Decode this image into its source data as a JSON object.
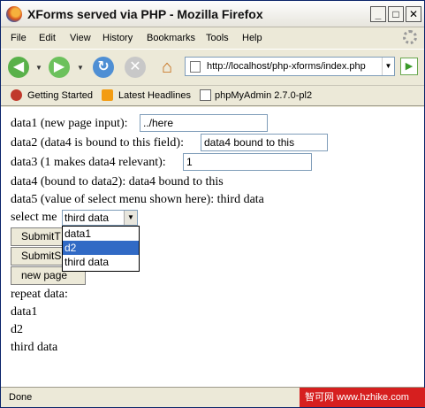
{
  "window": {
    "title": "XForms served via PHP - Mozilla Firefox"
  },
  "menu": [
    "File",
    "Edit",
    "View",
    "History",
    "Bookmarks",
    "Tools",
    "Help"
  ],
  "address": {
    "url": "http://localhost/php-xforms/index.php"
  },
  "bookmarks": [
    "Getting Started",
    "Latest Headlines",
    "phpMyAdmin 2.7.0-pl2"
  ],
  "form": {
    "data1_label": "data1 (new page input):",
    "data1_value": "../here",
    "data2_label": "data2 (data4 is bound to this field):",
    "data2_value": "data4 bound to this",
    "data3_label": "data3 (1 makes data4 relevant):",
    "data3_value": "1",
    "data4_line": "data4 (bound to data2): data4 bound to this",
    "data5_line": "data5 (value of select menu shown here): third data",
    "select_label": "select me",
    "select_value": "third data",
    "select_options": [
      "data1",
      "d2",
      "third data"
    ],
    "submit1": "SubmitT",
    "submit2": "SubmitS",
    "new_page": "new page",
    "repeat_label": "repeat data:",
    "repeat_items": [
      "data1",
      "d2",
      "third data"
    ]
  },
  "status": {
    "text": "Done"
  },
  "watermark": "智可网 www.hzhike.com"
}
